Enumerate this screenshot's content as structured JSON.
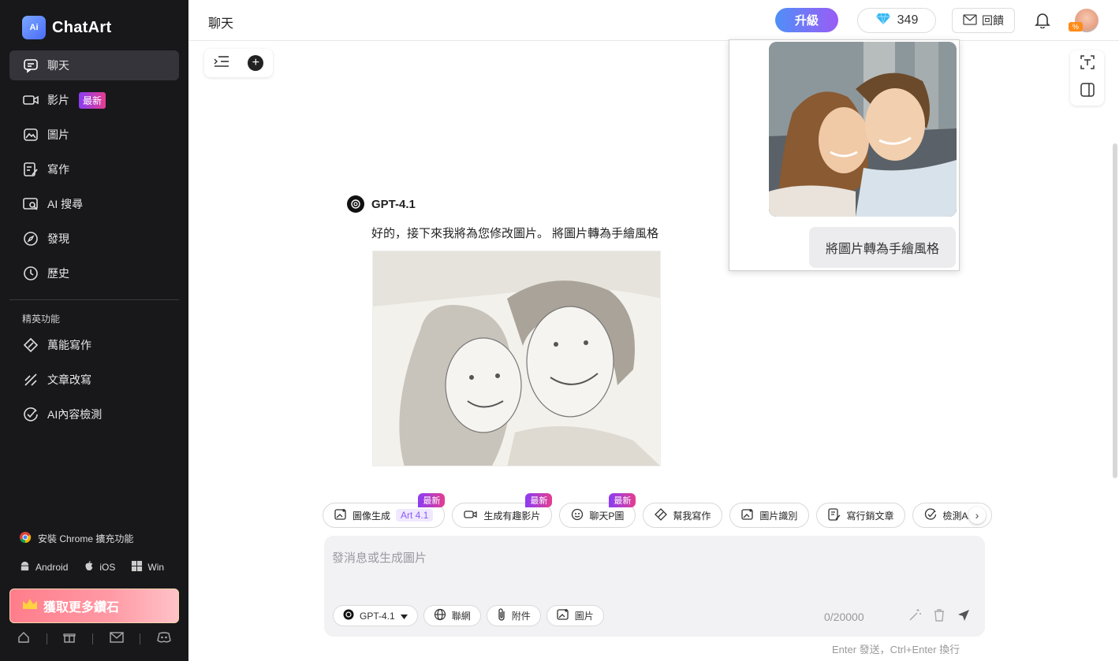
{
  "app": {
    "name": "ChatArt",
    "logo_mark": "Ai"
  },
  "sidebar": {
    "items": [
      {
        "label": "聊天",
        "icon": "chat-icon",
        "active": true
      },
      {
        "label": "影片",
        "icon": "video-icon",
        "badge": "最新"
      },
      {
        "label": "圖片",
        "icon": "image-icon"
      },
      {
        "label": "寫作",
        "icon": "writing-icon"
      },
      {
        "label": "AI 搜尋",
        "icon": "ai-search-icon"
      },
      {
        "label": "發現",
        "icon": "compass-icon"
      },
      {
        "label": "歷史",
        "icon": "history-icon"
      }
    ],
    "section_label": "精英功能",
    "elite_items": [
      {
        "label": "萬能寫作",
        "icon": "pen-icon"
      },
      {
        "label": "文章改寫",
        "icon": "rewrite-icon"
      },
      {
        "label": "AI內容檢測",
        "icon": "check-circle-icon"
      }
    ],
    "chrome_ext": "安裝 Chrome 擴充功能",
    "platforms": {
      "android": "Android",
      "ios": "iOS",
      "win": "Win"
    },
    "promo": "獲取更多鑽石",
    "bottom_icons": [
      "home-icon",
      "gift-icon",
      "mail-icon",
      "discord-icon"
    ]
  },
  "header": {
    "title": "聊天",
    "upgrade": "升級",
    "gems": "349",
    "feedback": "回饋"
  },
  "chat": {
    "model_name": "GPT-4.1",
    "reply_text": "好的，接下來我將為您修改圖片。 將圖片轉為手繪風格",
    "user_message": "將圖片轉為手繪風格"
  },
  "chips": [
    {
      "label": "圖像生成",
      "tag": "Art 4.1",
      "new": "最新",
      "icon": "image-gen-icon"
    },
    {
      "label": "生成有趣影片",
      "new": "最新",
      "icon": "video-icon"
    },
    {
      "label": "聊天P圖",
      "new": "最新",
      "icon": "image-chat-icon"
    },
    {
      "label": "幫我寫作",
      "icon": "pen-icon"
    },
    {
      "label": "圖片識別",
      "icon": "image-recognize-icon"
    },
    {
      "label": "寫行銷文章",
      "icon": "article-icon"
    },
    {
      "label": "檢測AI內",
      "icon": "check-circle-icon"
    }
  ],
  "composer": {
    "placeholder": "發消息或生成圖片",
    "model": "GPT-4.1",
    "web": "聯網",
    "attach": "附件",
    "image": "圖片",
    "counter": "0/20000",
    "hint": "Enter 發送，Ctrl+Enter 換行"
  },
  "colors": {
    "sidebar_bg": "#18181b",
    "accent_purple": "#9a5cf5",
    "accent_blue": "#4f8ff7",
    "badge_pink": "#e53d8f"
  }
}
